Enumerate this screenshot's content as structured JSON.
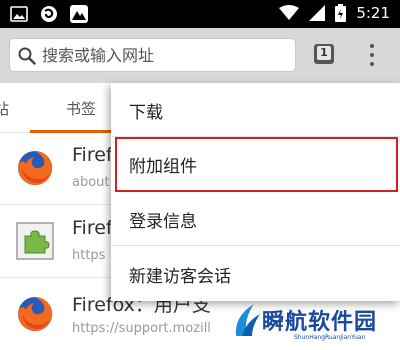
{
  "status_bar": {
    "time": "5:21",
    "icons": [
      "image-icon",
      "notification-icon",
      "mountain-icon",
      "wifi-icon",
      "signal-icon",
      "battery-icon"
    ]
  },
  "toolbar": {
    "search_placeholder": "搜索或输入网址",
    "tabs_count": "1"
  },
  "tab_strip": {
    "tabs": [
      {
        "label": "站"
      },
      {
        "label": "书签"
      }
    ],
    "accent_color": "#e66000"
  },
  "list": {
    "items": [
      {
        "title": "Firefox",
        "url": "about:f",
        "icon": "firefox-icon"
      },
      {
        "title": "Firefo",
        "url": "https",
        "icon": "puzzle-addon-icon"
      },
      {
        "title": "Firefox：用户支",
        "url": "https://support.mozill",
        "icon": "firefox-icon"
      }
    ]
  },
  "menu": {
    "items": [
      {
        "label": "下载"
      },
      {
        "label": "附加组件"
      },
      {
        "label": "登录信息"
      },
      {
        "label": "新建访客会话"
      }
    ],
    "highlight_color": "#cc2222"
  },
  "watermark": {
    "text": "瞬航软件园",
    "sub": "ShunHangRuanJianYuan"
  }
}
